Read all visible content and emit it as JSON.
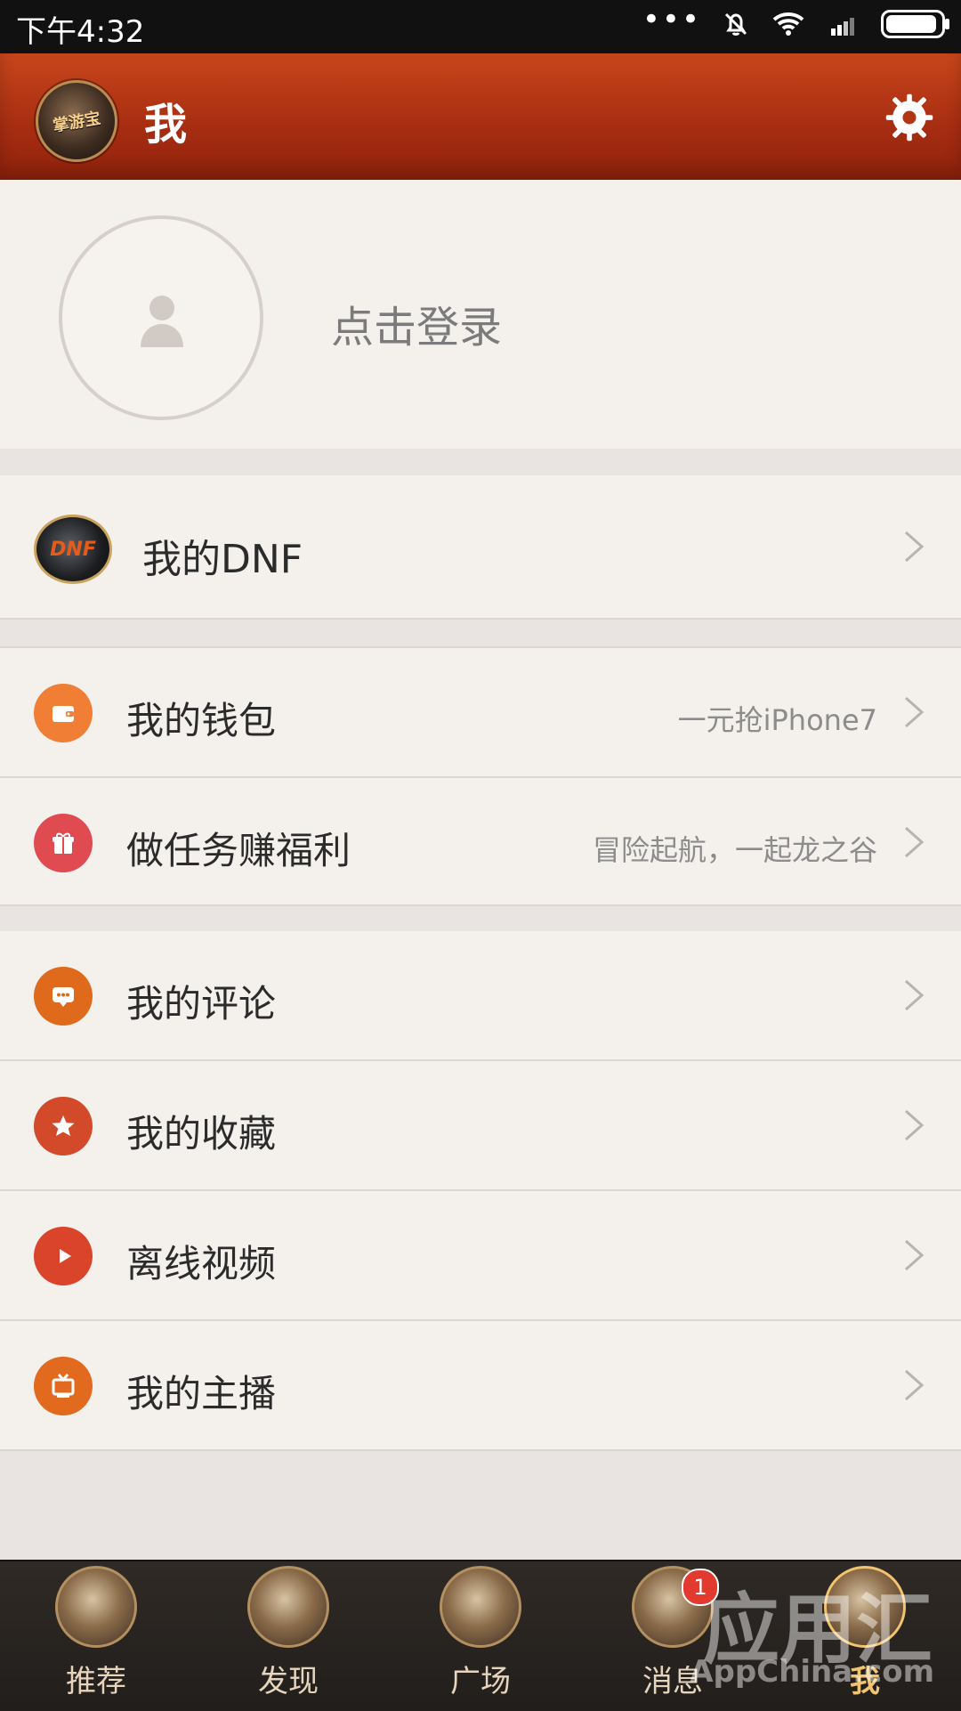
{
  "status_bar": {
    "time": "下午4:32"
  },
  "header": {
    "logo_text": "掌游宝",
    "title": "我"
  },
  "profile": {
    "login_text": "点击登录"
  },
  "dnf": {
    "logo_text": "DNF",
    "label": "我的DNF"
  },
  "menu": {
    "wallet": {
      "label": "我的钱包",
      "hint": "一元抢iPhone7",
      "icon": "wallet-icon",
      "color": "#f07f35"
    },
    "tasks": {
      "label": "做任务赚福利",
      "hint": "冒险起航，一起龙之谷",
      "icon": "gift-icon",
      "color": "#e04b52"
    },
    "comments": {
      "label": "我的评论",
      "icon": "comment-icon",
      "color": "#e06a1b"
    },
    "favorites": {
      "label": "我的收藏",
      "icon": "star-icon",
      "color": "#d24a2a"
    },
    "offline": {
      "label": "离线视频",
      "icon": "play-icon",
      "color": "#d9442a"
    },
    "streamers": {
      "label": "我的主播",
      "icon": "tv-icon",
      "color": "#e16a1e"
    }
  },
  "bottom_nav": {
    "items": [
      {
        "label": "推荐",
        "icon": "recommend-icon"
      },
      {
        "label": "发现",
        "icon": "discover-icon"
      },
      {
        "label": "广场",
        "icon": "square-icon"
      },
      {
        "label": "消息",
        "icon": "message-icon",
        "badge": "1"
      },
      {
        "label": "我",
        "icon": "me-icon",
        "active": true
      }
    ]
  },
  "watermark": {
    "text": "应用汇",
    "sub": "AppChina.com"
  }
}
